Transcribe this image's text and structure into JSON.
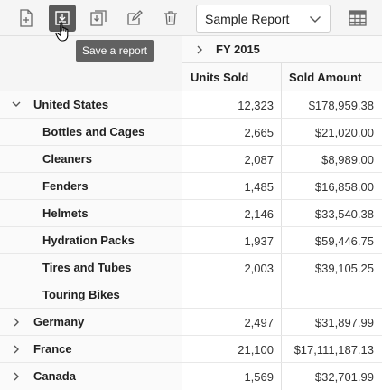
{
  "toolbar": {
    "buttons": [
      {
        "name": "new-report",
        "icon": "new-file-icon"
      },
      {
        "name": "save-report",
        "icon": "save-icon",
        "active": true
      },
      {
        "name": "save-as-report",
        "icon": "save-as-icon"
      },
      {
        "name": "rename-report",
        "icon": "edit-icon"
      },
      {
        "name": "remove-report",
        "icon": "trash-icon"
      }
    ],
    "report_select_value": "Sample Report",
    "tooltip": "Save a report",
    "grid_view_icon": "grid-icon"
  },
  "grid": {
    "column_group": "FY 2015",
    "columns": [
      "Units Sold",
      "Sold Amount"
    ],
    "rows": [
      {
        "label": "United States",
        "level": 0,
        "expanded": true,
        "units": "12,323",
        "amount": "$178,959.38"
      },
      {
        "label": "Bottles and Cages",
        "level": 1,
        "units": "2,665",
        "amount": "$21,020.00"
      },
      {
        "label": "Cleaners",
        "level": 1,
        "units": "2,087",
        "amount": "$8,989.00"
      },
      {
        "label": "Fenders",
        "level": 1,
        "units": "1,485",
        "amount": "$16,858.00"
      },
      {
        "label": "Helmets",
        "level": 1,
        "units": "2,146",
        "amount": "$33,540.38"
      },
      {
        "label": "Hydration Packs",
        "level": 1,
        "units": "1,937",
        "amount": "$59,446.75"
      },
      {
        "label": "Tires and Tubes",
        "level": 1,
        "units": "2,003",
        "amount": "$39,105.25"
      },
      {
        "label": "Touring Bikes",
        "level": 1,
        "units": "",
        "amount": ""
      },
      {
        "label": "Germany",
        "level": 0,
        "expanded": false,
        "units": "2,497",
        "amount": "$31,897.99"
      },
      {
        "label": "France",
        "level": 0,
        "expanded": false,
        "units": "21,100",
        "amount": "$17,111,187.13"
      },
      {
        "label": "Canada",
        "level": 0,
        "expanded": false,
        "units": "1,569",
        "amount": "$32,701.99"
      }
    ]
  }
}
